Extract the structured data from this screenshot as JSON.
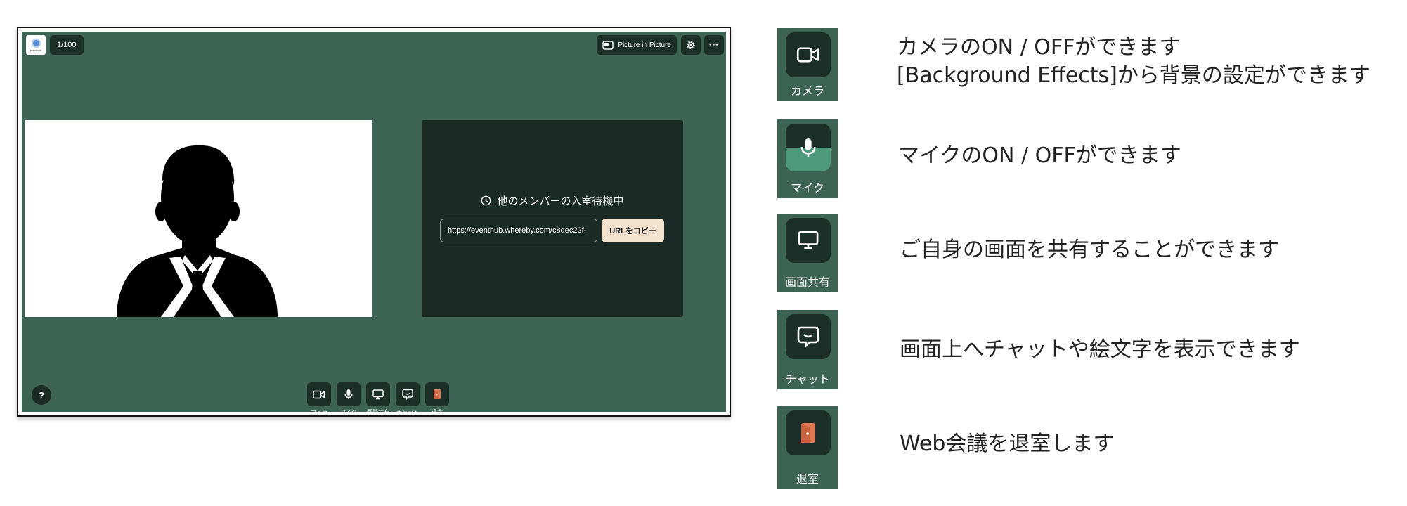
{
  "meeting": {
    "counter": "1/100",
    "logo_text": "eventhub",
    "pip_label": "Picture in Picture",
    "more_label": "⋯",
    "help_label": "?",
    "waiting_message": "他のメンバーの入室待機中",
    "room_url": "https://eventhub.whereby.com/c8dec22f-",
    "copy_button": "URLをコピー",
    "controls": [
      {
        "label": "カメラ"
      },
      {
        "label": "マイク"
      },
      {
        "label": "画面共有"
      },
      {
        "label": "チャット"
      },
      {
        "label": "退室"
      }
    ]
  },
  "legend": [
    {
      "label": "カメラ",
      "lines": [
        "カメラのON / OFFができます",
        "[Background Effects]から背景の設定ができます"
      ]
    },
    {
      "label": "マイク",
      "lines": [
        "マイクのON / OFFができます"
      ]
    },
    {
      "label": "画面共有",
      "lines": [
        "ご自身の画面を共有することができます"
      ]
    },
    {
      "label": "チャット",
      "lines": [
        "画面上へチャットや絵文字を表示できます"
      ]
    },
    {
      "label": "退室",
      "lines": [
        "Web会議を退室します"
      ]
    }
  ],
  "colors": {
    "stage": "#3d6355",
    "button": "#1b2f28",
    "mic_active": "#4f9a7c",
    "leave_accent": "#e07a55",
    "copy_button": "#f3e2cd"
  }
}
